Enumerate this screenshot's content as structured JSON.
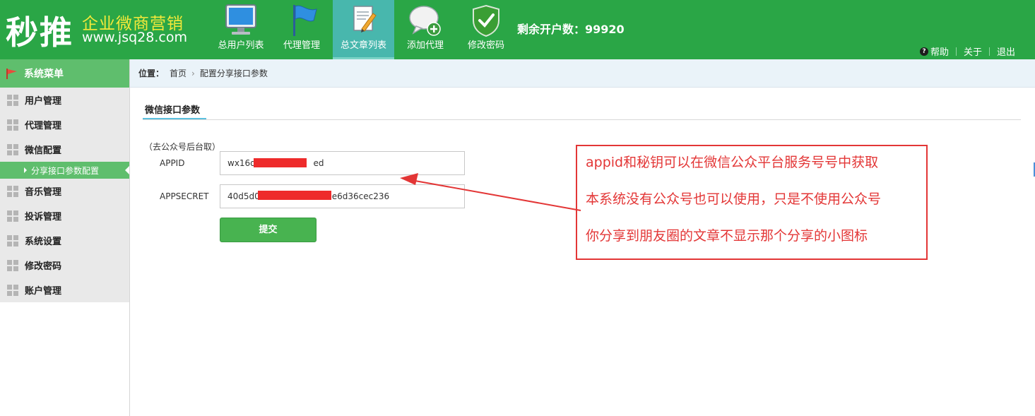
{
  "header": {
    "logo_main": "秒推",
    "logo_sub": "企业微商营销",
    "logo_url": "www.jsq28.com",
    "nav": [
      {
        "label": "总用户列表",
        "icon": "monitor-icon"
      },
      {
        "label": "代理管理",
        "icon": "flag-icon"
      },
      {
        "label": "总文章列表",
        "icon": "document-edit-icon",
        "active": true
      },
      {
        "label": "添加代理",
        "icon": "chat-add-icon"
      },
      {
        "label": "修改密码",
        "icon": "shield-check-icon"
      }
    ],
    "remaining_label": "剩余开户数：99920",
    "links": {
      "help": "帮助",
      "about": "关于",
      "logout": "退出"
    }
  },
  "sidebar": {
    "title": "系统菜单",
    "items": [
      {
        "label": "用户管理"
      },
      {
        "label": "代理管理"
      },
      {
        "label": "微信配置"
      },
      {
        "label": "分享接口参数配置",
        "sub": true,
        "active": true
      },
      {
        "label": "音乐管理"
      },
      {
        "label": "投诉管理"
      },
      {
        "label": "系统设置"
      },
      {
        "label": "修改密码"
      },
      {
        "label": "账户管理"
      }
    ]
  },
  "breadcrumb": {
    "label": "位置：",
    "home": "首页",
    "current": "配置分享接口参数"
  },
  "form": {
    "tab_title": "微信接口参数",
    "hint": "（去公众号后台取）",
    "appid_label": "APPID",
    "appid_prefix": "wx16d0",
    "appid_suffix": "ed",
    "appsecret_label": "APPSECRET",
    "appsecret_prefix": "40d5d0",
    "appsecret_suffix": "e6d36cec236",
    "submit_label": "提交"
  },
  "annotation": {
    "line1_prefix": "appid",
    "line1_rest": "和秘钥可以在微信公众平台服务号号中获取",
    "line2": "本系统没有公众号也可以使用，只是不使用公众号",
    "line3": "你分享到朋友圈的文章不显示那个分享的小图标"
  },
  "colors": {
    "header_green": "#2aa646",
    "sidebar_green": "#5fbe6d",
    "annotation_red": "#e33636",
    "redaction_red": "#ee2b2b"
  }
}
